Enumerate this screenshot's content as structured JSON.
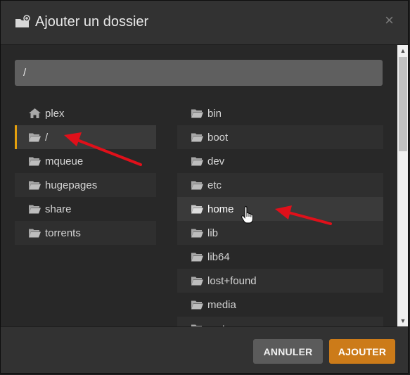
{
  "dialog": {
    "title": "Ajouter un dossier",
    "close_glyph": "×",
    "header_icon": "folder-add-icon"
  },
  "path_input": {
    "value": "/"
  },
  "left_list": [
    {
      "label": "plex",
      "icon": "home-icon"
    },
    {
      "label": "/",
      "icon": "folder-icon"
    },
    {
      "label": "mqueue",
      "icon": "folder-icon"
    },
    {
      "label": "hugepages",
      "icon": "folder-icon"
    },
    {
      "label": "share",
      "icon": "folder-icon"
    },
    {
      "label": "torrents",
      "icon": "folder-icon"
    }
  ],
  "right_list": [
    {
      "label": "bin",
      "icon": "folder-icon"
    },
    {
      "label": "boot",
      "icon": "folder-icon"
    },
    {
      "label": "dev",
      "icon": "folder-icon"
    },
    {
      "label": "etc",
      "icon": "folder-icon"
    },
    {
      "label": "home",
      "icon": "folder-icon"
    },
    {
      "label": "lib",
      "icon": "folder-icon"
    },
    {
      "label": "lib64",
      "icon": "folder-icon"
    },
    {
      "label": "lost+found",
      "icon": "folder-icon"
    },
    {
      "label": "media",
      "icon": "folder-icon"
    },
    {
      "label": "mnt",
      "icon": "folder-icon"
    }
  ],
  "footer": {
    "cancel_label": "ANNULER",
    "add_label": "AJOUTER"
  },
  "colors": {
    "accent": "#e5a00d",
    "add_button": "#cc7b19",
    "annotation_arrow": "#e0101a"
  }
}
